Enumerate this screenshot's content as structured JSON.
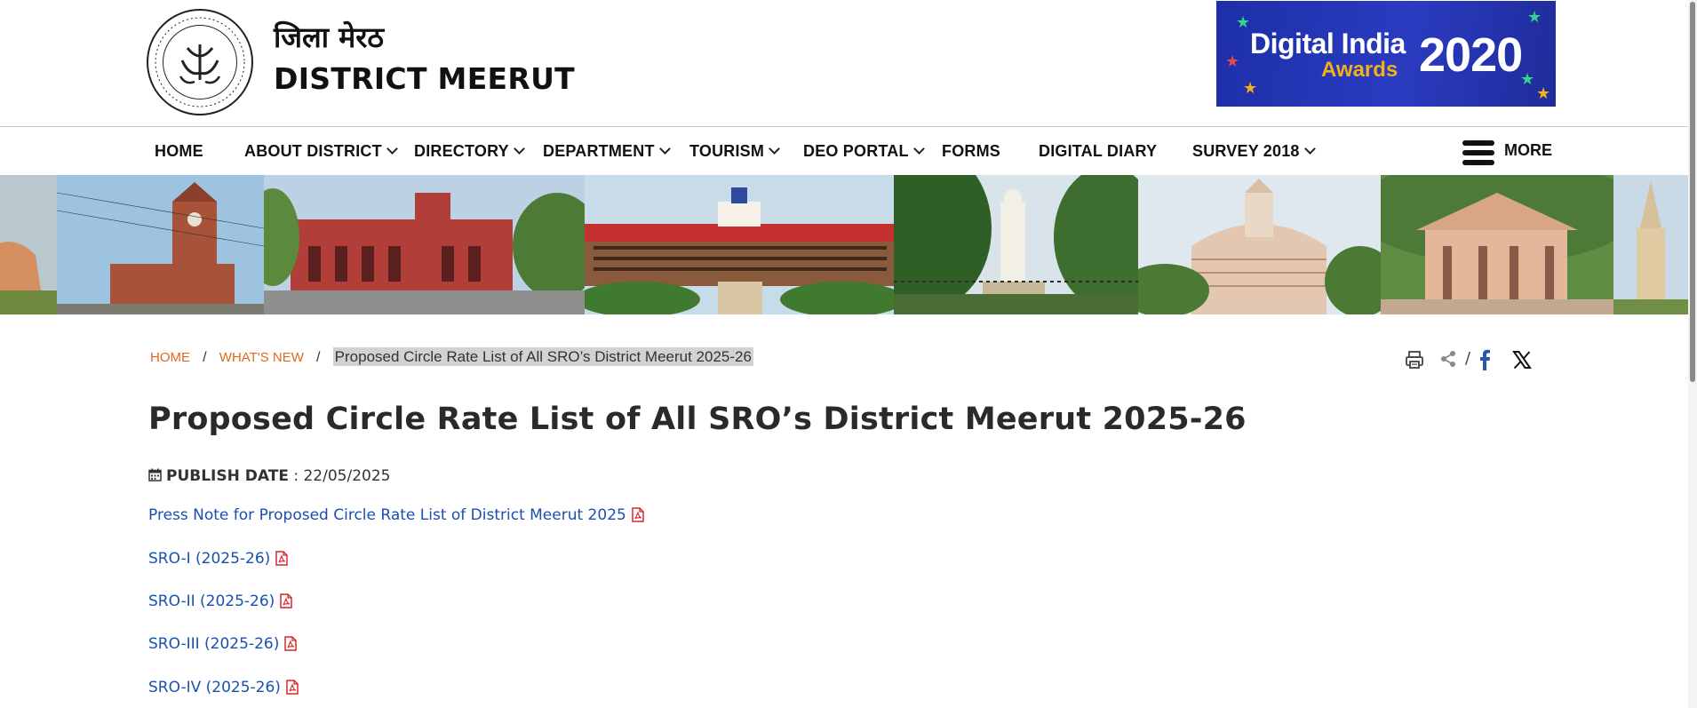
{
  "header": {
    "title_hi": "जिला मेरठ",
    "title_en": "DISTRICT MEERUT",
    "emblem_icon": "up-government-emblem-icon",
    "award": {
      "line1": "Digital India",
      "line2": "Awards",
      "year": "2020"
    }
  },
  "nav": {
    "items": [
      {
        "label": "HOME",
        "dropdown": false
      },
      {
        "label": "ABOUT DISTRICT",
        "dropdown": true
      },
      {
        "label": "DIRECTORY",
        "dropdown": true
      },
      {
        "label": "DEPARTMENT",
        "dropdown": true
      },
      {
        "label": "TOURISM",
        "dropdown": true
      },
      {
        "label": "DEO PORTAL",
        "dropdown": true
      },
      {
        "label": "FORMS",
        "dropdown": false
      },
      {
        "label": "DIGITAL DIARY",
        "dropdown": false
      },
      {
        "label": "SURVEY 2018",
        "dropdown": true
      }
    ],
    "more_label": "MORE",
    "more_icon": "hamburger-menu-icon"
  },
  "banner": {
    "photos": [
      "stupa-tower",
      "clock-tower",
      "red-brick-building",
      "university-building",
      "gandhi-statue",
      "stupa-tower",
      "temple-pavilion",
      "church-spire"
    ]
  },
  "breadcrumb": {
    "home": "HOME",
    "parent": "WHAT'S NEW",
    "separator": "/",
    "current": "Proposed Circle Rate List of All SRO’s District Meerut 2025-26"
  },
  "share": {
    "separator": "/",
    "icons": [
      "print-icon",
      "share-icon",
      "facebook-icon",
      "x-twitter-icon"
    ]
  },
  "article": {
    "title": "Proposed Circle Rate List of All SRO’s District Meerut 2025-26",
    "publish_label": "PUBLISH DATE",
    "publish_colon": ":",
    "publish_date": "22/05/2025",
    "links": [
      "Press Note for Proposed Circle Rate List of District Meerut 2025",
      "SRO-I (2025-26)",
      "SRO-II (2025-26)",
      "SRO-III (2025-26)",
      "SRO-IV (2025-26)"
    ]
  },
  "colors": {
    "breadcrumb_link": "#e2691b",
    "document_link": "#1a4fb0",
    "pdf_icon": "#d9262c",
    "award_bg": "#2a3bc0",
    "award_accent": "#f2b019"
  }
}
